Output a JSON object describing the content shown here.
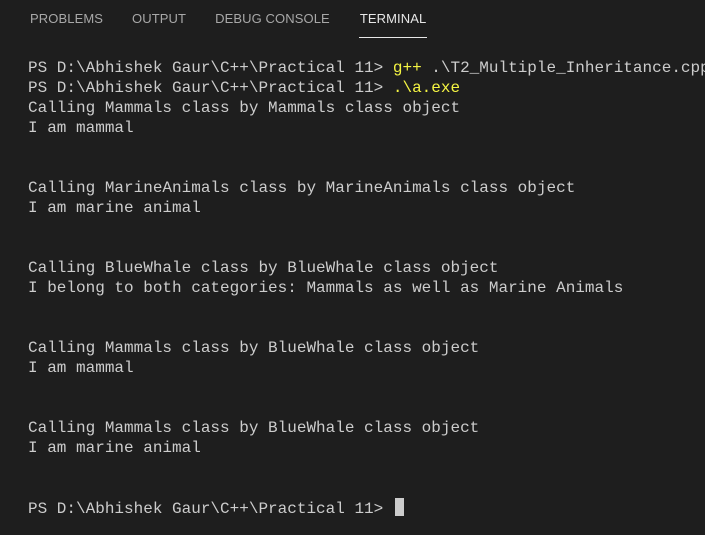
{
  "tabs": [
    {
      "label": "PROBLEMS"
    },
    {
      "label": "OUTPUT"
    },
    {
      "label": "DEBUG CONSOLE"
    },
    {
      "label": "TERMINAL"
    }
  ],
  "terminal": {
    "prompt": "PS D:\\Abhishek Gaur\\C++\\Practical 11> ",
    "cmd1_prog": "g++",
    "cmd1_arg": " .\\T2_Multiple_Inheritance.cpp",
    "cmd2_prog": ".\\a.exe",
    "output": [
      "Calling Mammals class by Mammals class object",
      "I am mammal",
      "Calling MarineAnimals class by MarineAnimals class object",
      "I am marine animal",
      "Calling BlueWhale class by BlueWhale class object",
      "I belong to both categories: Mammals as well as Marine Animals",
      "Calling Mammals class by BlueWhale class object",
      "I am mammal",
      "Calling Mammals class by BlueWhale class object",
      "I am marine animal"
    ]
  }
}
